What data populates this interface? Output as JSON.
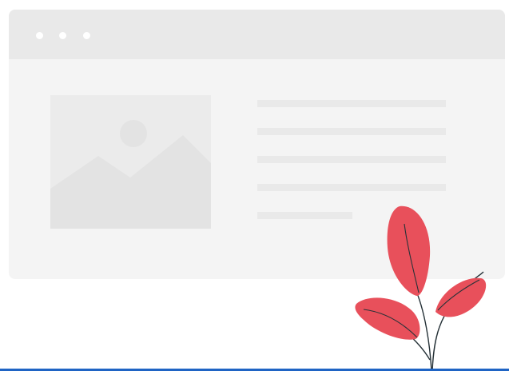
{
  "colors": {
    "window_background": "#f4f4f4",
    "titlebar_background": "#e9e9e9",
    "placeholder_fill": "#ebebeb",
    "placeholder_shape": "#e3e3e3",
    "leaf": "#e8505b",
    "stem": "#263238",
    "accent_bar": "#1f64c4"
  },
  "icons": {
    "window_dots": [
      "window-dot-icon",
      "window-dot-icon",
      "window-dot-icon"
    ],
    "image": "image-placeholder-icon",
    "plant": "plant-leaves-icon"
  },
  "text_lines_count": 5
}
